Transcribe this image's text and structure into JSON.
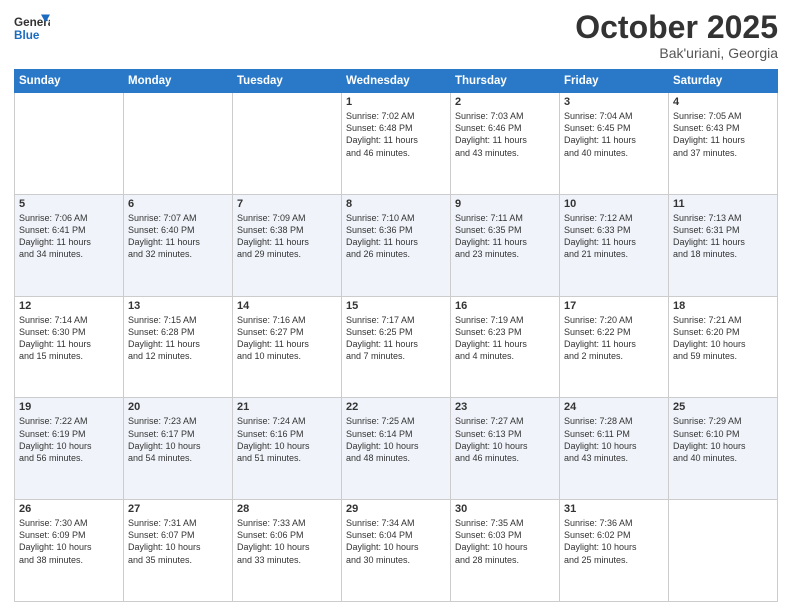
{
  "header": {
    "logo_general": "General",
    "logo_blue": "Blue",
    "month_title": "October 2025",
    "location": "Bak'uriani, Georgia"
  },
  "weekdays": [
    "Sunday",
    "Monday",
    "Tuesday",
    "Wednesday",
    "Thursday",
    "Friday",
    "Saturday"
  ],
  "weeks": [
    [
      {
        "day": "",
        "info": ""
      },
      {
        "day": "",
        "info": ""
      },
      {
        "day": "",
        "info": ""
      },
      {
        "day": "1",
        "info": "Sunrise: 7:02 AM\nSunset: 6:48 PM\nDaylight: 11 hours\nand 46 minutes."
      },
      {
        "day": "2",
        "info": "Sunrise: 7:03 AM\nSunset: 6:46 PM\nDaylight: 11 hours\nand 43 minutes."
      },
      {
        "day": "3",
        "info": "Sunrise: 7:04 AM\nSunset: 6:45 PM\nDaylight: 11 hours\nand 40 minutes."
      },
      {
        "day": "4",
        "info": "Sunrise: 7:05 AM\nSunset: 6:43 PM\nDaylight: 11 hours\nand 37 minutes."
      }
    ],
    [
      {
        "day": "5",
        "info": "Sunrise: 7:06 AM\nSunset: 6:41 PM\nDaylight: 11 hours\nand 34 minutes."
      },
      {
        "day": "6",
        "info": "Sunrise: 7:07 AM\nSunset: 6:40 PM\nDaylight: 11 hours\nand 32 minutes."
      },
      {
        "day": "7",
        "info": "Sunrise: 7:09 AM\nSunset: 6:38 PM\nDaylight: 11 hours\nand 29 minutes."
      },
      {
        "day": "8",
        "info": "Sunrise: 7:10 AM\nSunset: 6:36 PM\nDaylight: 11 hours\nand 26 minutes."
      },
      {
        "day": "9",
        "info": "Sunrise: 7:11 AM\nSunset: 6:35 PM\nDaylight: 11 hours\nand 23 minutes."
      },
      {
        "day": "10",
        "info": "Sunrise: 7:12 AM\nSunset: 6:33 PM\nDaylight: 11 hours\nand 21 minutes."
      },
      {
        "day": "11",
        "info": "Sunrise: 7:13 AM\nSunset: 6:31 PM\nDaylight: 11 hours\nand 18 minutes."
      }
    ],
    [
      {
        "day": "12",
        "info": "Sunrise: 7:14 AM\nSunset: 6:30 PM\nDaylight: 11 hours\nand 15 minutes."
      },
      {
        "day": "13",
        "info": "Sunrise: 7:15 AM\nSunset: 6:28 PM\nDaylight: 11 hours\nand 12 minutes."
      },
      {
        "day": "14",
        "info": "Sunrise: 7:16 AM\nSunset: 6:27 PM\nDaylight: 11 hours\nand 10 minutes."
      },
      {
        "day": "15",
        "info": "Sunrise: 7:17 AM\nSunset: 6:25 PM\nDaylight: 11 hours\nand 7 minutes."
      },
      {
        "day": "16",
        "info": "Sunrise: 7:19 AM\nSunset: 6:23 PM\nDaylight: 11 hours\nand 4 minutes."
      },
      {
        "day": "17",
        "info": "Sunrise: 7:20 AM\nSunset: 6:22 PM\nDaylight: 11 hours\nand 2 minutes."
      },
      {
        "day": "18",
        "info": "Sunrise: 7:21 AM\nSunset: 6:20 PM\nDaylight: 10 hours\nand 59 minutes."
      }
    ],
    [
      {
        "day": "19",
        "info": "Sunrise: 7:22 AM\nSunset: 6:19 PM\nDaylight: 10 hours\nand 56 minutes."
      },
      {
        "day": "20",
        "info": "Sunrise: 7:23 AM\nSunset: 6:17 PM\nDaylight: 10 hours\nand 54 minutes."
      },
      {
        "day": "21",
        "info": "Sunrise: 7:24 AM\nSunset: 6:16 PM\nDaylight: 10 hours\nand 51 minutes."
      },
      {
        "day": "22",
        "info": "Sunrise: 7:25 AM\nSunset: 6:14 PM\nDaylight: 10 hours\nand 48 minutes."
      },
      {
        "day": "23",
        "info": "Sunrise: 7:27 AM\nSunset: 6:13 PM\nDaylight: 10 hours\nand 46 minutes."
      },
      {
        "day": "24",
        "info": "Sunrise: 7:28 AM\nSunset: 6:11 PM\nDaylight: 10 hours\nand 43 minutes."
      },
      {
        "day": "25",
        "info": "Sunrise: 7:29 AM\nSunset: 6:10 PM\nDaylight: 10 hours\nand 40 minutes."
      }
    ],
    [
      {
        "day": "26",
        "info": "Sunrise: 7:30 AM\nSunset: 6:09 PM\nDaylight: 10 hours\nand 38 minutes."
      },
      {
        "day": "27",
        "info": "Sunrise: 7:31 AM\nSunset: 6:07 PM\nDaylight: 10 hours\nand 35 minutes."
      },
      {
        "day": "28",
        "info": "Sunrise: 7:33 AM\nSunset: 6:06 PM\nDaylight: 10 hours\nand 33 minutes."
      },
      {
        "day": "29",
        "info": "Sunrise: 7:34 AM\nSunset: 6:04 PM\nDaylight: 10 hours\nand 30 minutes."
      },
      {
        "day": "30",
        "info": "Sunrise: 7:35 AM\nSunset: 6:03 PM\nDaylight: 10 hours\nand 28 minutes."
      },
      {
        "day": "31",
        "info": "Sunrise: 7:36 AM\nSunset: 6:02 PM\nDaylight: 10 hours\nand 25 minutes."
      },
      {
        "day": "",
        "info": ""
      }
    ]
  ]
}
